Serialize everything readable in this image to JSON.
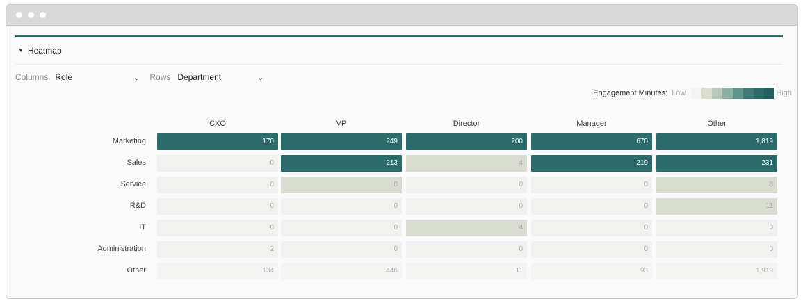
{
  "section": {
    "title": "Heatmap"
  },
  "controls": {
    "columns_label": "Columns",
    "columns_value": "Role",
    "rows_label": "Rows",
    "rows_value": "Department"
  },
  "legend": {
    "title": "Engagement Minutes:",
    "low": "Low",
    "high": "High",
    "ramp": [
      "#f4f4f2",
      "#dcdccf",
      "#b9c9bc",
      "#8bb0a2",
      "#5e948a",
      "#3f7b76",
      "#2b6b6b",
      "#255e5f"
    ]
  },
  "chart_data": {
    "type": "heatmap",
    "title": "Heatmap",
    "x": [
      "CXO",
      "VP",
      "Director",
      "Manager",
      "Other"
    ],
    "y": [
      "Marketing",
      "Sales",
      "Service",
      "R&D",
      "IT",
      "Administration",
      "Other"
    ],
    "values": [
      [
        170,
        249,
        200,
        670,
        1819
      ],
      [
        0,
        213,
        4,
        219,
        231
      ],
      [
        0,
        8,
        0,
        0,
        8
      ],
      [
        0,
        0,
        0,
        0,
        11
      ],
      [
        0,
        0,
        4,
        0,
        0
      ],
      [
        2,
        0,
        0,
        0,
        0
      ],
      [
        134,
        446,
        11,
        93,
        1919
      ]
    ],
    "labels": [
      [
        "170",
        "249",
        "200",
        "670",
        "1,819"
      ],
      [
        "0",
        "213",
        "4",
        "219",
        "231"
      ],
      [
        "0",
        "8",
        "0",
        "0",
        "8"
      ],
      [
        "0",
        "0",
        "0",
        "0",
        "11"
      ],
      [
        "0",
        "0",
        "4",
        "0",
        "0"
      ],
      [
        "2",
        "0",
        "0",
        "0",
        "0"
      ],
      [
        "134",
        "446",
        "11",
        "93",
        "1,919"
      ]
    ],
    "cell_colors": [
      [
        "#2b6b6b",
        "#2b6b6b",
        "#2b6b6b",
        "#2b6b6b",
        "#2b6b6b"
      ],
      [
        "#f1f1ef",
        "#2b6b6b",
        "#d9dcd1",
        "#2b6b6b",
        "#2b6b6b"
      ],
      [
        "#f1f1ef",
        "#d9dcd1",
        "#f1f1ef",
        "#f1f1ef",
        "#d9dcd1"
      ],
      [
        "#f1f1ef",
        "#f1f1ef",
        "#f1f1ef",
        "#f1f1ef",
        "#d9dcd1"
      ],
      [
        "#f1f1ef",
        "#f1f1ef",
        "#d9dcd1",
        "#f1f1ef",
        "#f1f1ef"
      ],
      [
        "#f1f1ef",
        "#f1f1ef",
        "#f1f1ef",
        "#f1f1ef",
        "#f1f1ef"
      ],
      [
        "#f4f4f2",
        "#f4f4f2",
        "#f4f4f2",
        "#f4f4f2",
        "#f4f4f2"
      ]
    ],
    "dark_text": "#ffffff",
    "light_text": "#aaaaaa"
  }
}
